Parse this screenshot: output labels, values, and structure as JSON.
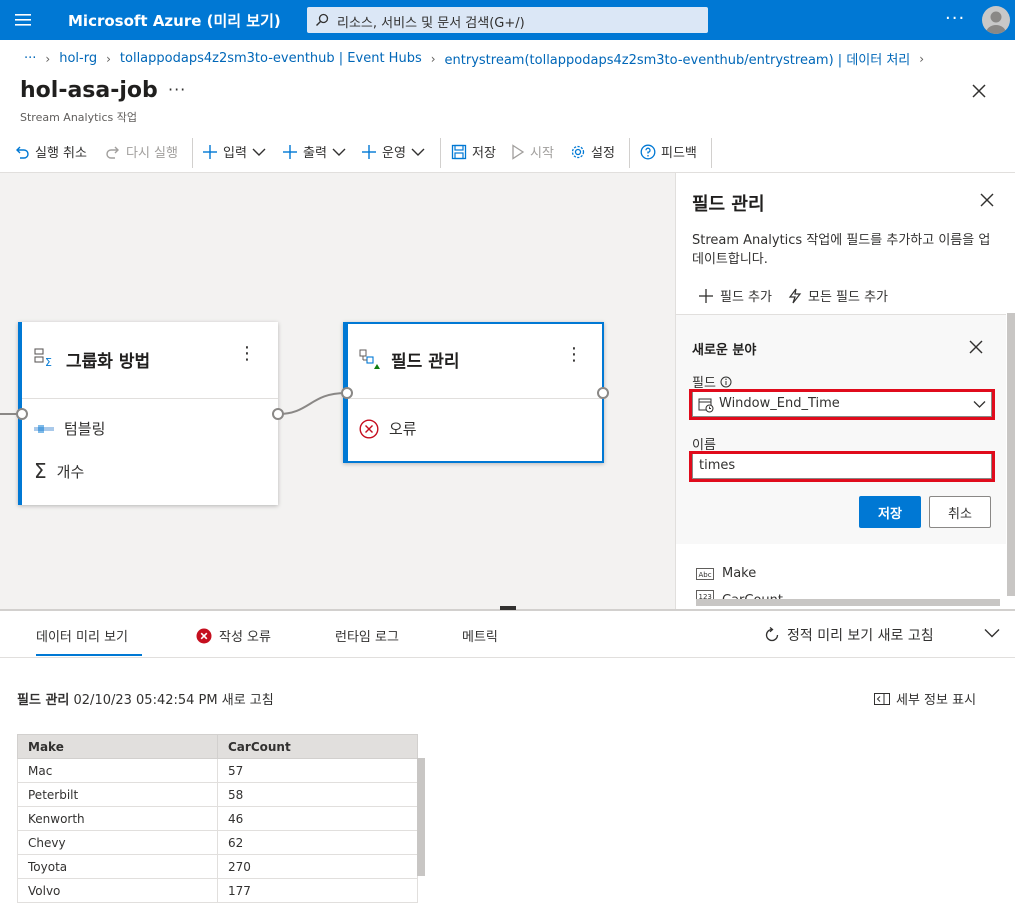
{
  "topbar": {
    "title": "Microsoft Azure (미리 보기)",
    "search_placeholder": "리소스, 서비스 및 문서 검색(G+/)",
    "more": "···"
  },
  "breadcrumb": {
    "ellipsis": "···",
    "items": [
      "hol-rg",
      "tollappodaps4z2sm3to-eventhub | Event Hubs",
      "entrystream(tollappodaps4z2sm3to-eventhub/entrystream) | 데이터 처리"
    ]
  },
  "page": {
    "title": "hol-asa-job",
    "more": "···",
    "subtitle": "Stream Analytics 작업"
  },
  "toolbar": {
    "undo": "실행 취소",
    "redo": "다시 실행",
    "input": "입력",
    "output": "출력",
    "operations": "운영",
    "save": "저장",
    "start": "시작",
    "settings": "설정",
    "feedback": "피드백"
  },
  "canvas": {
    "group_node": {
      "title": "그룹화 방법",
      "rows": [
        "텀블링",
        "개수"
      ]
    },
    "manage_node": {
      "title": "필드 관리",
      "rows": [
        "오류"
      ]
    }
  },
  "panel": {
    "title": "필드 관리",
    "description": "Stream Analytics 작업에 필드를 추가하고 이름을 업데이트합니다.",
    "add_field": "필드 추가",
    "add_all_fields": "모든 필드 추가",
    "form": {
      "title": "새로운 분야",
      "field_label": "필드",
      "field_value": "Window_End_Time",
      "name_label": "이름",
      "name_value": "times",
      "save": "저장",
      "cancel": "취소"
    },
    "fields": [
      {
        "type": "Abc",
        "name": "Make"
      },
      {
        "type": "123",
        "name": "CarCount"
      }
    ]
  },
  "bottom": {
    "tabs": [
      "데이터 미리 보기",
      "작성 오류",
      "런타임 로그",
      "메트릭"
    ],
    "refresh": "정적 미리 보기 새로 고침",
    "preview_title": "필드 관리",
    "preview_time": "02/10/23 05:42:54 PM 새로 고침",
    "details": "세부 정보 표시",
    "table": {
      "columns": [
        "Make",
        "CarCount"
      ],
      "rows": [
        [
          "Mac",
          "57"
        ],
        [
          "Peterbilt",
          "58"
        ],
        [
          "Kenworth",
          "46"
        ],
        [
          "Chevy",
          "62"
        ],
        [
          "Toyota",
          "270"
        ],
        [
          "Volvo",
          "177"
        ]
      ]
    }
  },
  "colors": {
    "azure_blue": "#0078d4",
    "highlight_red": "#e00b1c",
    "error_red": "#c50f1f"
  }
}
